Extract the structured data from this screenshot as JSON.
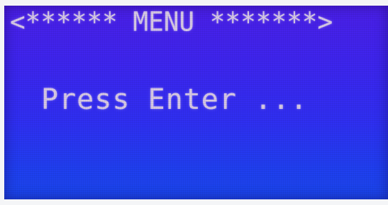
{
  "display": {
    "header": "<****** MENU *******>",
    "prompt": "Press Enter ..."
  },
  "colors": {
    "screen_top": "#4b1fe8",
    "screen_bottom": "#1a46ec",
    "text": "#d7c9e6"
  }
}
